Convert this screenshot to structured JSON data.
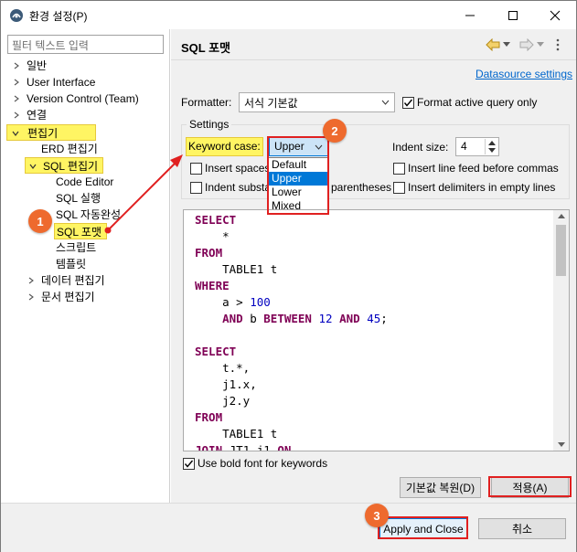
{
  "window": {
    "title": "환경 설정(P)",
    "icons": [
      "app-icon",
      "minimize-icon",
      "maximize-icon",
      "close-icon"
    ]
  },
  "tree": {
    "filter_placeholder": "필터 텍스트 입력",
    "items": [
      {
        "label": "일반"
      },
      {
        "label": "User Interface"
      },
      {
        "label": "Version Control (Team)"
      },
      {
        "label": "연결"
      },
      {
        "label": "편집기"
      },
      {
        "label": "ERD 편집기"
      },
      {
        "label": "SQL 편집기"
      },
      {
        "label": "Code Editor"
      },
      {
        "label": "SQL 실행"
      },
      {
        "label": "SQL 자동완성"
      },
      {
        "label": "SQL 포맷"
      },
      {
        "label": "스크립트"
      },
      {
        "label": "템플릿"
      },
      {
        "label": "데이터 편집기"
      },
      {
        "label": "문서 편집기"
      }
    ]
  },
  "page": {
    "title": "SQL 포맷",
    "datasource_link": "Datasource settings",
    "formatter_label": "Formatter:",
    "formatter_value": "서식 기본값",
    "format_active_label": "Format active query only",
    "settings_label": "Settings",
    "keyword_case_label": "Keyword case:",
    "keyword_case_value": "Upper",
    "keyword_case_options": [
      "Default",
      "Upper",
      "Lower",
      "Mixed"
    ],
    "indent_size_label": "Indent size:",
    "indent_size_value": "4",
    "insert_spaces_label": "Insert spaces",
    "insert_line_feed_label": "Insert line feed before commas",
    "indent_subst_label": "Indent substa",
    "parentheses_label": "parentheses",
    "insert_delimiters_label": "Insert delimiters in empty lines",
    "bold_font_label": "Use bold font for keywords",
    "restore_defaults": "기본값 복원(D)",
    "apply": "적용(A)"
  },
  "bottom": {
    "apply_close": "Apply and Close",
    "cancel": "취소"
  },
  "preview": {
    "l1": "SELECT",
    "l2": "*",
    "l3": "FROM",
    "l4": "TABLE1 t",
    "l5": "WHERE",
    "l6a": "a > ",
    "l6b": "100",
    "l7a": "AND",
    "l7b": " b ",
    "l7c": "BETWEEN",
    "l7d": "12",
    "l7e": "AND",
    "l7f": "45",
    "l7g": ";",
    "l9": "SELECT",
    "l10": "t.*,",
    "l11": "j1.x,",
    "l12": "j2.y",
    "l13": "FROM",
    "l14": "TABLE1 t",
    "l15a": "JOIN",
    "l15b": "JT1 j1",
    "l15c": "ON"
  },
  "annotations": {
    "badges": [
      "1",
      "2",
      "3"
    ],
    "highlight_color": "#fff563",
    "badge_color": "#ee6a2e",
    "arrow_color": "#e02020"
  }
}
